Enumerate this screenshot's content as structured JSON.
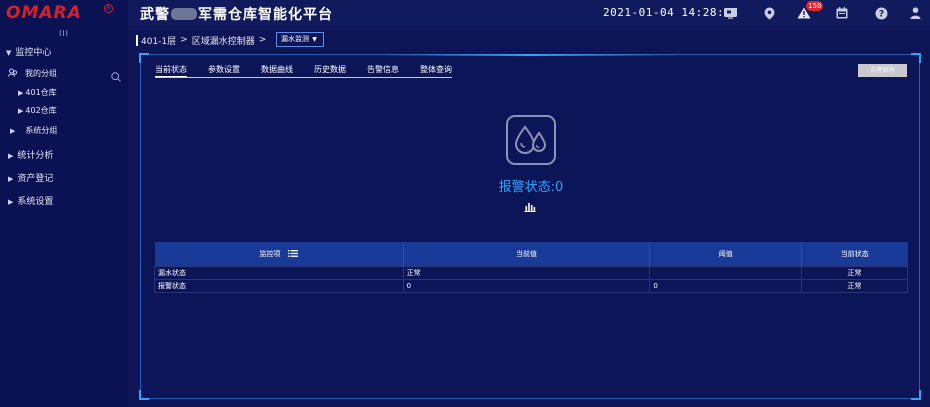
{
  "header": {
    "logo_text": "OMARA",
    "logo_mark": "R",
    "title_before": "武警",
    "title_after": "军需仓库智能化平台",
    "datetime": "2021-01-04 14:28:57",
    "alarm_badge": "158",
    "icons": [
      "monitor-icon",
      "location-pin-icon",
      "warning-icon",
      "calendar-icon",
      "help-icon",
      "user-icon"
    ]
  },
  "sidebar": {
    "collapse_glyph": "III",
    "monitor_center": "监控中心",
    "my_group": "我的分组",
    "warehouse_401": "401仓库",
    "warehouse_402": "402仓库",
    "system_group": "系统分组",
    "stats": "统计分析",
    "assets": "资产登记",
    "settings": "系统设置"
  },
  "breadcrumb": {
    "floor": "401-1层",
    "sep1": ">",
    "controller": "区域漏水控制器",
    "sep2": ">",
    "selected": "漏水监测"
  },
  "tabs": [
    "当前状态",
    "参数设置",
    "数据曲线",
    "历史数据",
    "告警信息",
    "整体查询"
  ],
  "alarm_release_button": "告警解除",
  "status": {
    "label": "报警状态:0"
  },
  "table": {
    "headers": [
      "监控项",
      "当前值",
      "阈值",
      "当前状态"
    ],
    "rows": [
      [
        "漏水状态",
        "正常",
        "",
        "正常"
      ],
      [
        "报警状态",
        "0",
        "0",
        "正常"
      ]
    ]
  },
  "colors": {
    "background": "#0d1557",
    "sidebar": "#0a1253",
    "accent": "#2aa5ff",
    "table_header": "#193a96",
    "logo_red": "#d8202a",
    "badge_red": "#e0282e"
  }
}
